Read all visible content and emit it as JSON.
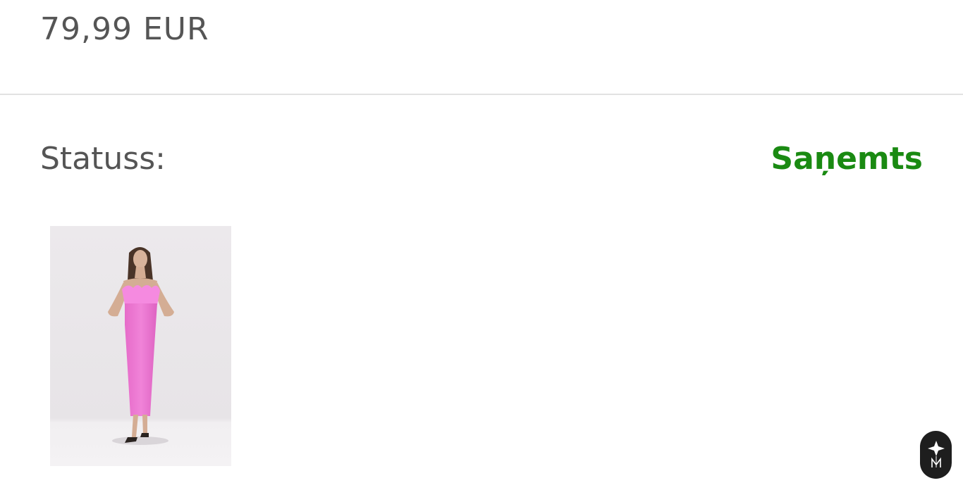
{
  "order": {
    "price": "79,99 EUR",
    "status_label": "Statuss:",
    "status_value": "Saņemts",
    "status_color": "#1a8a12"
  },
  "product": {
    "image": "pink-feather-trim-satin-maxi-dress-photo"
  },
  "widget": {
    "icon": "brand-logo-icon"
  }
}
